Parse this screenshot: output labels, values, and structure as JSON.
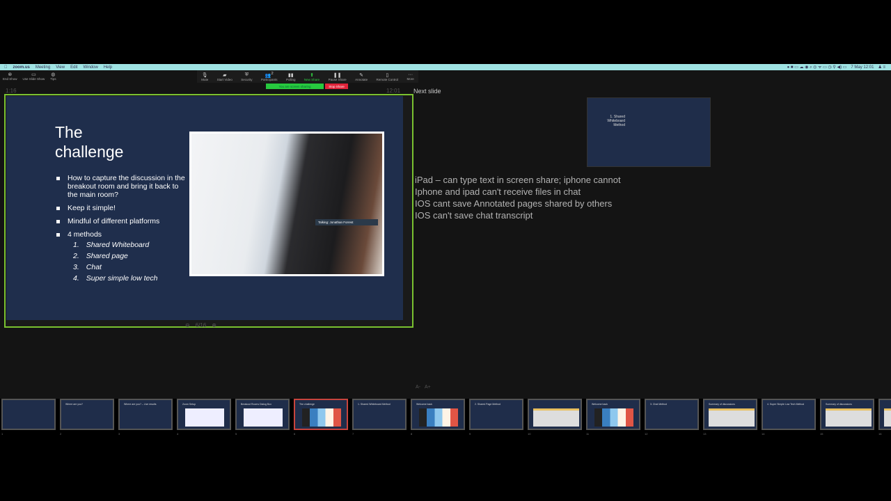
{
  "menubar": {
    "app": "zoom.us",
    "items": [
      "Meeting",
      "View",
      "Edit",
      "Window",
      "Help"
    ],
    "date_time": "7 May 12:01"
  },
  "presenter_tools": [
    {
      "label": "End Show",
      "icon": "end-show-icon"
    },
    {
      "label": "Use Slide Show",
      "icon": "slideshow-icon"
    },
    {
      "label": "Tips",
      "icon": "tips-icon"
    }
  ],
  "zoom_toolbar": [
    {
      "label": "Mute",
      "icon": "microphone-icon"
    },
    {
      "label": "Start Video",
      "icon": "video-off-icon"
    },
    {
      "label": "Security",
      "icon": "shield-icon"
    },
    {
      "label": "Participants",
      "icon": "participants-icon",
      "count": "2"
    },
    {
      "label": "Polling",
      "icon": "polling-icon"
    },
    {
      "label": "New Share",
      "icon": "share-icon",
      "highlight": "#2ecc40"
    },
    {
      "label": "Pause Share",
      "icon": "pause-icon"
    },
    {
      "label": "Annotate",
      "icon": "pen-icon"
    },
    {
      "label": "Remote Control",
      "icon": "mouse-icon"
    },
    {
      "label": "More",
      "icon": "more-icon"
    }
  ],
  "share_status": {
    "text": "You are screen sharing",
    "stop_label": "Stop Share",
    "green": "#27c93f",
    "red": "#e0243a"
  },
  "presenter": {
    "elapsed": "1:16",
    "clock": "12:01",
    "next_slide_label": "Next slide",
    "slide_counter": "6/16",
    "border_color": "#7ac230"
  },
  "current_slide": {
    "title": "The challenge",
    "bullets": [
      "How to capture the discussion in the breakout room and bring it back to the main room?",
      "Keep it simple!",
      "Mindful of different platforms",
      "4 methods"
    ],
    "methods": [
      {
        "num": "1.",
        "text": "Shared Whiteboard"
      },
      {
        "num": "2.",
        "text": "Shared page"
      },
      {
        "num": "3.",
        "text": "Chat"
      },
      {
        "num": "4.",
        "text": "Super simple low tech"
      }
    ],
    "photo_caption": "Talking: Jonathan Forrest",
    "background": "#1f2e4c"
  },
  "next_slide": {
    "title": "1. Shared Whiteboard Method"
  },
  "notes": [
    "iPad – can type text in screen share; iphone cannot",
    "Iphone and ipad can't receive files in chat",
    "IOS cant save Annotated pages shared by others",
    "IOS can't save chat transcript"
  ],
  "font_controls": [
    "A-",
    "A+"
  ],
  "thumbnails": [
    {
      "n": "1",
      "title": "",
      "kind": "text"
    },
    {
      "n": "2",
      "title": "Where are you?",
      "kind": "text"
    },
    {
      "n": "3",
      "title": "Where are you? – Live results",
      "kind": "text"
    },
    {
      "n": "4",
      "title": "Zoom Setup",
      "kind": "screenshot"
    },
    {
      "n": "5",
      "title": "Breakout Rooms Dialog Box",
      "kind": "screenshot"
    },
    {
      "n": "6",
      "title": "The challenge",
      "kind": "photo",
      "selected": true
    },
    {
      "n": "7",
      "title": "1. Shared Whiteboard Method",
      "kind": "text"
    },
    {
      "n": "8",
      "title": "Welcome back",
      "kind": "photo"
    },
    {
      "n": "9",
      "title": "2. Shared Page Method",
      "kind": "text"
    },
    {
      "n": "10",
      "title": "",
      "kind": "sheet"
    },
    {
      "n": "11",
      "title": "Welcome back",
      "kind": "photo"
    },
    {
      "n": "12",
      "title": "3. Chat Method",
      "kind": "text"
    },
    {
      "n": "13",
      "title": "Summary of discussions",
      "kind": "sheet"
    },
    {
      "n": "14",
      "title": "4. Super Simple Low Tech Method",
      "kind": "text"
    },
    {
      "n": "15",
      "title": "Summary of discussions",
      "kind": "sheet"
    },
    {
      "n": "16",
      "title": "",
      "kind": "sheet"
    }
  ]
}
